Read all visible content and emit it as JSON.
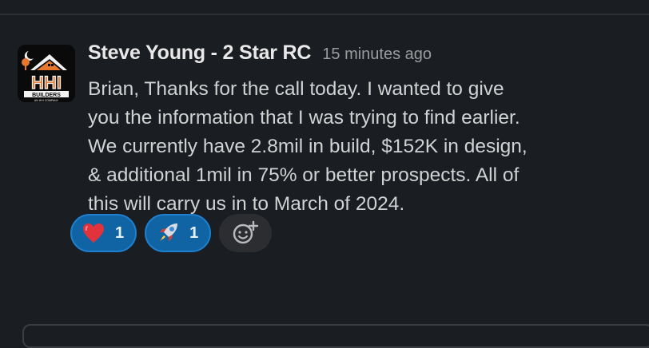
{
  "message": {
    "author": "Steve Young - 2 Star RC",
    "timestamp": "15 minutes ago",
    "lines": [
      "Brian, Thanks for the call today. I wanted to give",
      "you the information that I was trying to find earlier.",
      "We currently have 2.8mil in build, $152K in design,",
      "& additional 1mil in 75% or better prospects. All of",
      "this will carry us in to March of 2024."
    ],
    "avatar": {
      "logo_text": "HHI",
      "sub_text": "BUILDERS",
      "tagline": "AN HHI COMPANY",
      "brand_color": "#e8772e"
    }
  },
  "reactions": [
    {
      "emoji": "red-heart",
      "count": "1"
    },
    {
      "emoji": "rocket",
      "count": "1"
    }
  ],
  "add_reaction": {
    "icon": "add-emoji-icon"
  },
  "colors": {
    "background": "#1a1d21",
    "reaction_pill": "#1164a3",
    "reaction_border": "#1d7fce"
  }
}
